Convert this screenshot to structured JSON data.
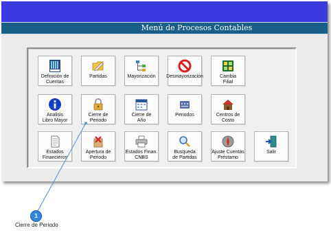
{
  "window": {
    "title": "Menú de Procesos Contables"
  },
  "buttons": [
    {
      "label": "Definición de\nCuentas",
      "icon": "ledger-book-icon"
    },
    {
      "label": "Partidas",
      "icon": "folder-edit-icon"
    },
    {
      "label": "Mayorización",
      "icon": "hierarchy-tree-icon"
    },
    {
      "label": "Desmayorización",
      "icon": "prohibited-icon"
    },
    {
      "label": "Cambia\nFilial",
      "icon": "grid-switch-icon"
    },
    {
      "label": "Analisis\nLibro Mayor",
      "icon": "info-icon"
    },
    {
      "label": "Cierre de\nPeriodo",
      "icon": "padlock-icon"
    },
    {
      "label": "Cierre de\nAño",
      "icon": "calendar-icon"
    },
    {
      "label": "Periodos",
      "icon": "calendar-grid-icon"
    },
    {
      "label": "Centros de\nCosto",
      "icon": "house-icon"
    },
    {
      "label": "Estados\nFinancieros",
      "icon": "document-icon"
    },
    {
      "label": "Apertura de\nPeriodo",
      "icon": "package-icon"
    },
    {
      "label": "Estados Finan.\nCNBS",
      "icon": "printer-icon"
    },
    {
      "label": "Busqueda\nde Partidas",
      "icon": "magnifier-icon"
    },
    {
      "label": "Ajuste Cuentas\nPréstamo",
      "icon": "compass-icon"
    },
    {
      "label": "Salir",
      "icon": "exit-door-icon"
    }
  ],
  "callout": {
    "number": "1",
    "caption": "Cierre de Periodo"
  },
  "colors": {
    "title_top": "#3a3ae0",
    "title_bar": "#1b5e86",
    "callout": "#2f86dd"
  }
}
